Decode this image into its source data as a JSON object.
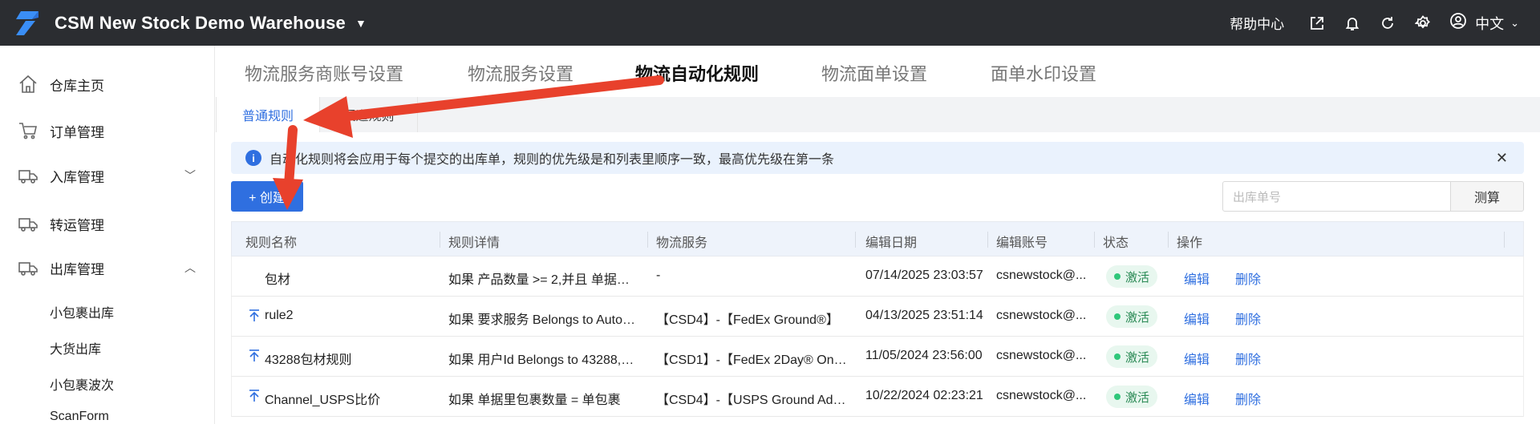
{
  "header": {
    "title": "CSM New Stock Demo Warehouse",
    "help": "帮助中心",
    "language": "中文",
    "icons": [
      "logo-icon",
      "share-icon",
      "bell-icon",
      "refresh-icon",
      "settings-icon",
      "user-icon"
    ]
  },
  "sidebar": {
    "items": [
      {
        "label": "仓库主页",
        "icon": "home-icon"
      },
      {
        "label": "订单管理",
        "icon": "cart-icon"
      },
      {
        "label": "入库管理",
        "icon": "inbound-truck-icon"
      },
      {
        "label": "转运管理",
        "icon": "transfer-truck-icon"
      },
      {
        "label": "出库管理",
        "icon": "outbound-truck-icon"
      }
    ],
    "subitems": [
      "小包裹出库",
      "大货出库",
      "小包裹波次",
      "ScanForm"
    ]
  },
  "top_tabs": [
    "物流服务商账号设置",
    "物流服务设置",
    "物流自动化规则",
    "物流面单设置",
    "面单水印设置"
  ],
  "active_top_tab": "物流自动化规则",
  "sub_tabs": [
    "普通规则",
    "渠道规则"
  ],
  "notice": "自动化规则将会应用于每个提交的出库单，规则的优先级是和列表里顺序一致，最高优先级在第一条",
  "create_label": "+ 创建",
  "search": {
    "placeholder": "出库单号",
    "button": "测算"
  },
  "table": {
    "columns": [
      "规则名称",
      "规则详情",
      "物流服务",
      "编辑日期",
      "编辑账号",
      "状态",
      "操作"
    ],
    "rows": [
      {
        "name": "包材",
        "detail": "如果 产品数量 >= 2,并且 单据里包...",
        "service": "-",
        "date": "07/14/2025 23:03:57",
        "account": "csnewstock@...",
        "status": "激活",
        "edit": "编辑",
        "delete": "删除",
        "priority_icon": false
      },
      {
        "name": "rule2",
        "detail": "如果 要求服务 Belongs to Automat...",
        "service": "【CSD4】-【FedEx Ground®】",
        "date": "04/13/2025 23:51:14",
        "account": "csnewstock@...",
        "status": "激活",
        "edit": "编辑",
        "delete": "删除",
        "priority_icon": true
      },
      {
        "name": "43288包材规则",
        "detail": "如果 用户Id Belongs to 43288,并...",
        "service": "【CSD1】-【FedEx 2Day® One R...",
        "date": "11/05/2024 23:56:00",
        "account": "csnewstock@...",
        "status": "激活",
        "edit": "编辑",
        "delete": "删除",
        "priority_icon": true
      },
      {
        "name": "Channel_USPS比价",
        "detail": "如果 单据里包裹数量 = 单包裹",
        "service": "【CSD4】-【USPS Ground Advan...",
        "date": "10/22/2024 02:23:21",
        "account": "csnewstock@...",
        "status": "激活",
        "edit": "编辑",
        "delete": "删除",
        "priority_icon": true
      }
    ]
  },
  "colors": {
    "topbar": "#2b2d31",
    "accent": "#2f6fe0",
    "annotation": "#e8412c",
    "status_bg": "#e8f7ef"
  }
}
